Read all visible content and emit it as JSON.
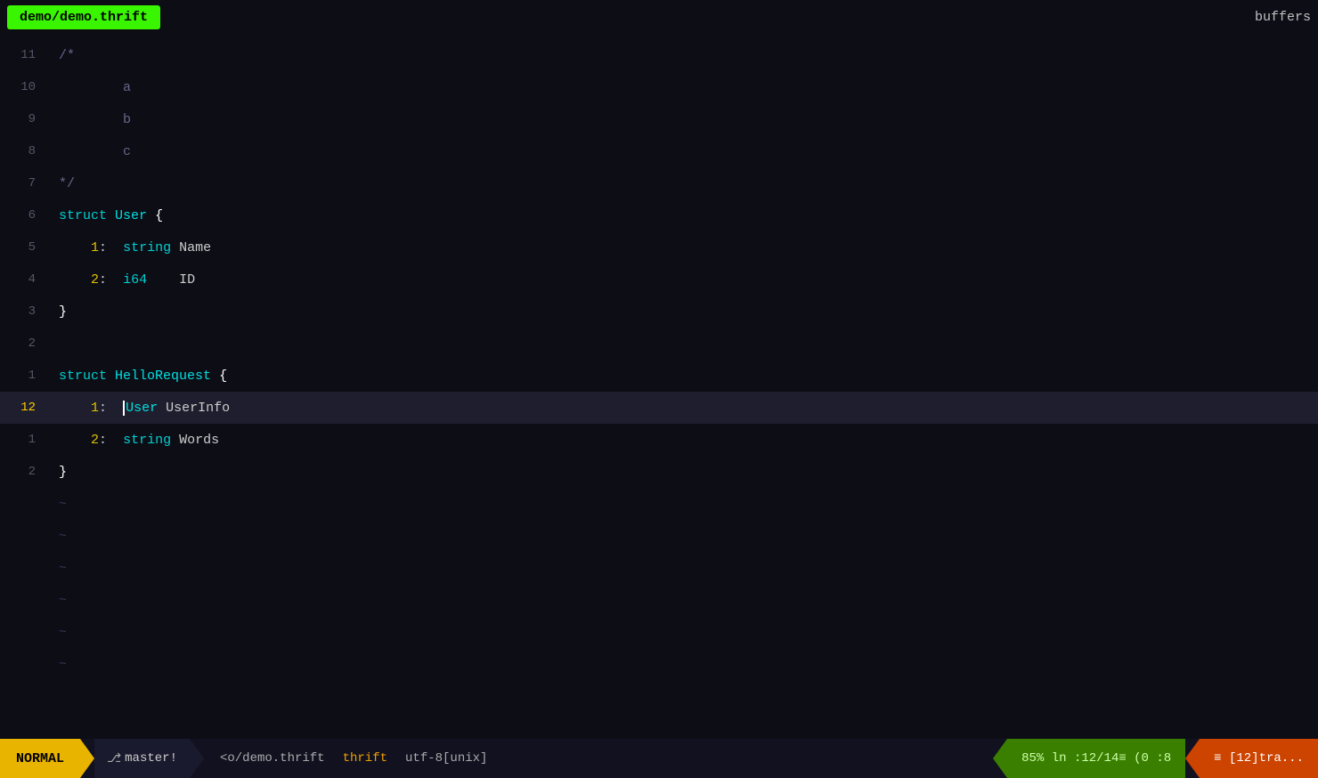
{
  "title_bar": {
    "file_tab": "demo/demo.thrift",
    "buffers_label": "buffers"
  },
  "status_bar": {
    "mode": "NORMAL",
    "git": "  master!",
    "file": "<o/demo.thrift",
    "filetype": "thrift",
    "encoding": "utf-8[unix]",
    "percent": "85%",
    "position": "ln :12/14",
    "col": "(0 :8",
    "buffer": "≡ [12]tra..."
  },
  "code_lines": [
    {
      "number": "11",
      "content": "/*",
      "type": "comment",
      "active": false
    },
    {
      "number": "10",
      "content": "        a",
      "type": "comment",
      "active": false
    },
    {
      "number": "9",
      "content": "        b",
      "type": "comment",
      "active": false
    },
    {
      "number": "8",
      "content": "        c",
      "type": "comment",
      "active": false
    },
    {
      "number": "7",
      "content": "*/",
      "type": "comment",
      "active": false
    },
    {
      "number": "6",
      "content": "struct User {",
      "type": "struct",
      "active": false
    },
    {
      "number": "5",
      "content": "    1:  string Name",
      "type": "field",
      "active": false
    },
    {
      "number": "4",
      "content": "    2:  i64    ID",
      "type": "field",
      "active": false
    },
    {
      "number": "3",
      "content": "}",
      "type": "brace",
      "active": false
    },
    {
      "number": "2",
      "content": "",
      "type": "empty",
      "active": false
    },
    {
      "number": "1",
      "content": "struct HelloRequest {",
      "type": "struct",
      "active": false
    },
    {
      "number": "12",
      "content": "    1:  User UserInfo",
      "type": "field",
      "active": true
    },
    {
      "number": "1",
      "content": "    2:  string Words",
      "type": "field",
      "active": false
    },
    {
      "number": "2",
      "content": "}",
      "type": "brace",
      "active": false
    }
  ],
  "tilde_lines": 6,
  "colors": {
    "background": "#0d0d16",
    "active_line": "#1e1e2e",
    "comment": "#666688",
    "keyword": "#00cccc",
    "number_yellow": "#ccaa00",
    "text": "#cccccc",
    "brace": "#ffffff",
    "line_num_inactive": "#555566",
    "line_num_active": "#ffcc00"
  }
}
